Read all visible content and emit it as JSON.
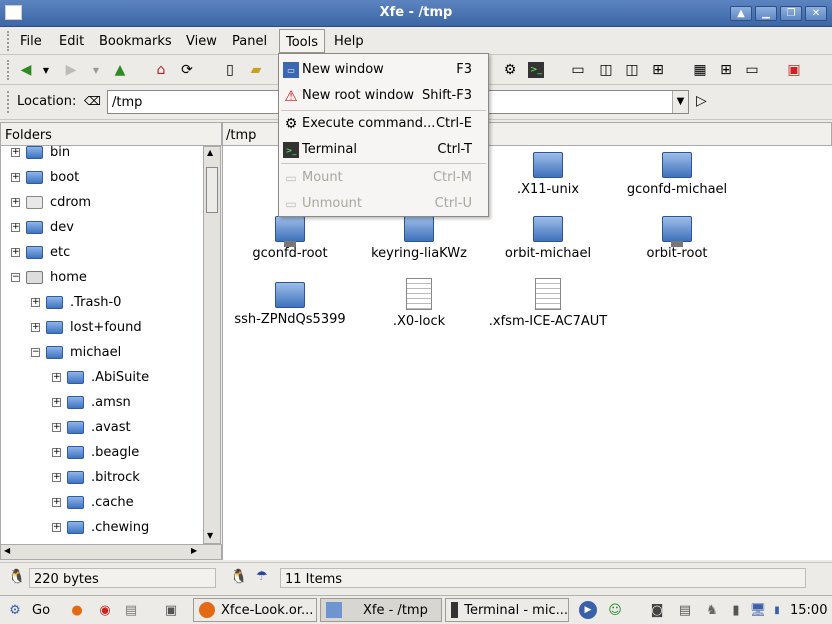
{
  "window": {
    "title": "Xfe - /tmp"
  },
  "menubar": [
    {
      "label": "File",
      "underline": "F"
    },
    {
      "label": "Edit"
    },
    {
      "label": "Bookmarks"
    },
    {
      "label": "View"
    },
    {
      "label": "Panel"
    },
    {
      "label": "Tools"
    },
    {
      "label": "Help"
    }
  ],
  "location": {
    "label": "Location:",
    "value": "/tmp"
  },
  "folders": {
    "header": "Folders",
    "items": [
      "bin",
      "boot",
      "cdrom",
      "dev",
      "etc",
      "home",
      ".Trash-0",
      "lost+found",
      "michael",
      ".AbiSuite",
      ".amsn",
      ".avast",
      ".beagle",
      ".bitrock",
      ".cache",
      ".chewing"
    ]
  },
  "files": {
    "path": "/tmp",
    "items": [
      ".X11-unix",
      "gconfd-michael",
      "gconfd-root",
      "keyring-liaKWz",
      "orbit-michael",
      "orbit-root",
      "ssh-ZPNdQs5399",
      ".X0-lock",
      ".xfsm-ICE-AC7AUT"
    ]
  },
  "status": {
    "left": "220 bytes",
    "right": "11 Items"
  },
  "tools_menu": [
    {
      "label": "New window",
      "accel": "F3",
      "icon": "new-window-icon"
    },
    {
      "label": "New root window",
      "accel": "Shift-F3",
      "icon": "warning-icon"
    },
    {
      "label": "Execute command...",
      "accel": "Ctrl-E",
      "icon": "gears-icon"
    },
    {
      "label": "Terminal",
      "accel": "Ctrl-T",
      "icon": "terminal-icon"
    },
    {
      "label": "Mount",
      "accel": "Ctrl-M",
      "icon": "mount-icon",
      "disabled": true
    },
    {
      "label": "Unmount",
      "accel": "Ctrl-U",
      "icon": "unmount-icon",
      "disabled": true
    }
  ],
  "taskbar": {
    "go": "Go",
    "tasks": [
      "Xfce-Look.or...",
      "Xfe - /tmp",
      "Terminal - mic..."
    ],
    "clock": "15:00"
  },
  "colors": {
    "titlebar": "#3d66a6",
    "folder": "#3f74c0"
  }
}
